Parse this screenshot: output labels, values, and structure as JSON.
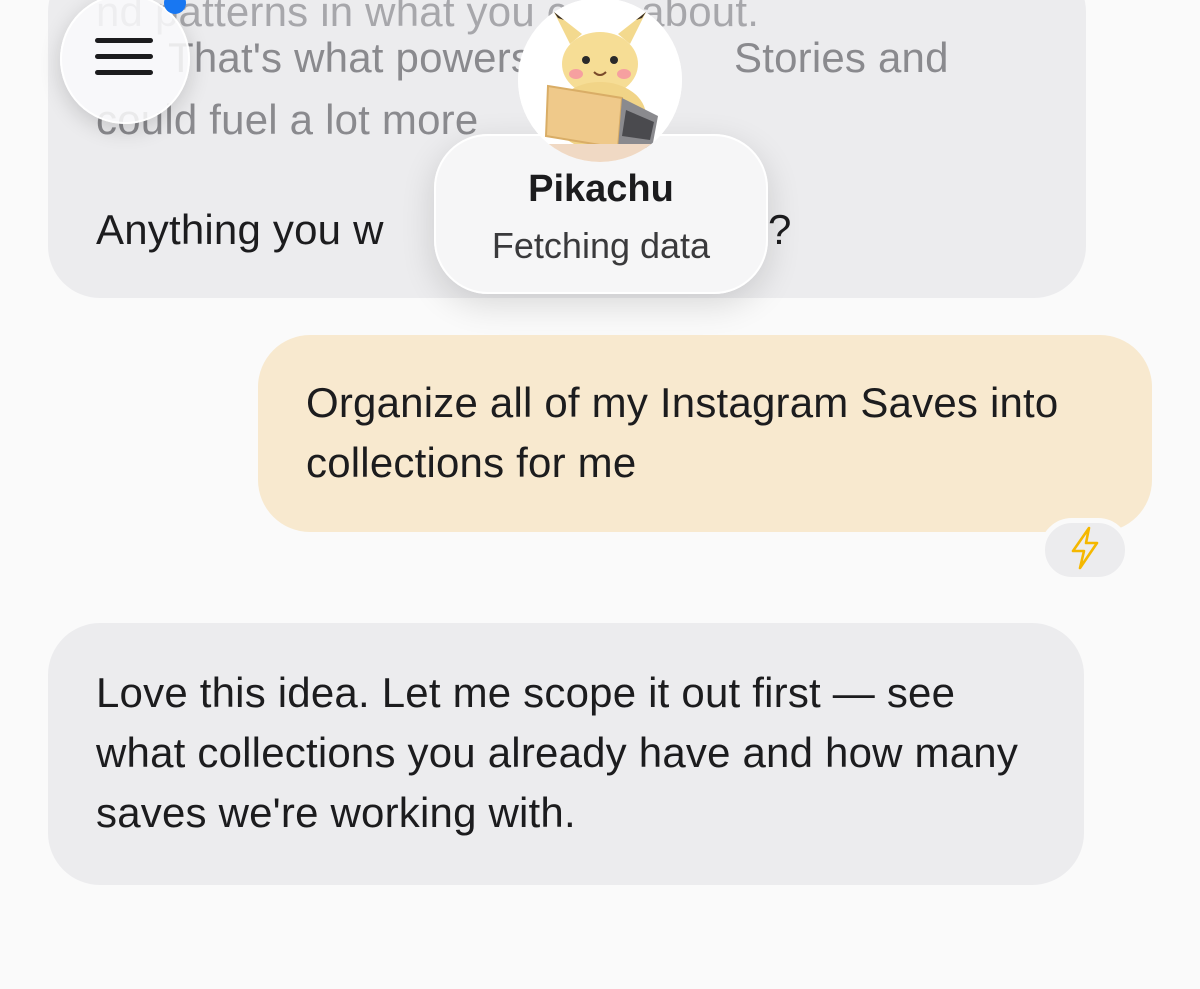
{
  "conversation": {
    "previous_message": {
      "lines": [
        "nd patterns in what you care about.",
        "That's what powers",
        "Stories and",
        "could fuel a lot more",
        "Anything you w",
        "?"
      ]
    },
    "user_message": {
      "text": "Organize all of my Instagram Saves into collections for me",
      "reaction_icon": "lightning-icon"
    },
    "assistant_reply": {
      "text": "Love this idea. Let me scope it out first — see what collections you already have and how many saves we're working with."
    }
  },
  "header": {
    "menu_icon": "hamburger-menu-icon",
    "agent": {
      "name": "Pikachu",
      "status": "Fetching data",
      "avatar_icon": "pikachu-laptop-avatar"
    }
  },
  "colors": {
    "background": "#fafafa",
    "assistant_bubble": "#ececee",
    "user_bubble": "#f8e9cf",
    "notification_dot": "#1877f2",
    "lightning": "#f5c518"
  }
}
